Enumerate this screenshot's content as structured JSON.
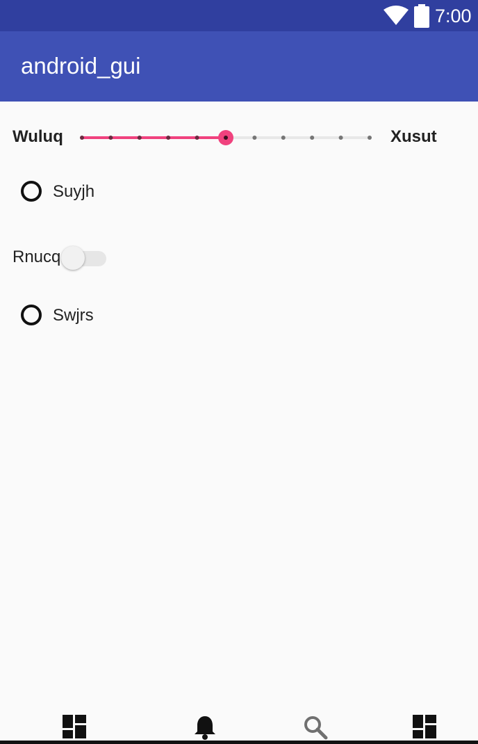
{
  "status_bar": {
    "time": "7:00",
    "icons": [
      "wifi-icon",
      "battery-icon"
    ]
  },
  "app_bar": {
    "title": "android_gui"
  },
  "slider": {
    "min_label": "Wuluq",
    "max_label": "Xusut",
    "steps": 10,
    "value_step": 5,
    "active_color": "#f0427e",
    "inactive_color": "#e8e8e8"
  },
  "radio_1": {
    "label": "Suyjh",
    "checked": false
  },
  "switch": {
    "label": "Rnucq",
    "on": false
  },
  "radio_2": {
    "label": "Swjrs",
    "checked": false
  },
  "bottom_nav": {
    "items": [
      {
        "icon": "dashboard-icon"
      },
      {
        "icon": "bell-icon"
      },
      {
        "icon": "search-icon"
      },
      {
        "icon": "dashboard-icon"
      }
    ]
  },
  "colors": {
    "status_bar": "#303f9f",
    "app_bar": "#3f51b5",
    "background": "#fafafa"
  }
}
